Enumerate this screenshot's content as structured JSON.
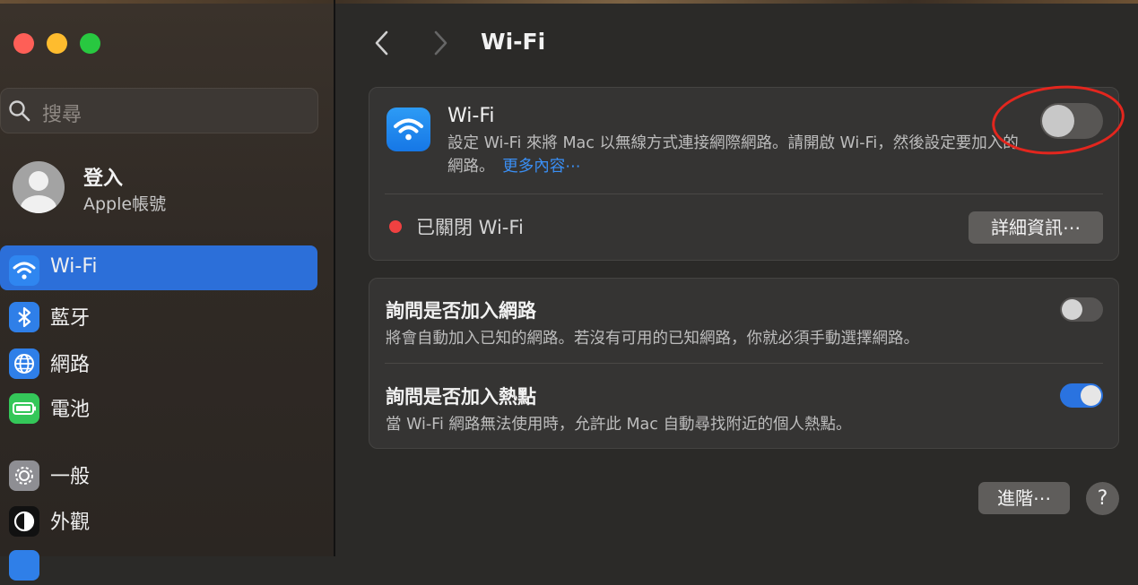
{
  "sidebar": {
    "search_placeholder": "搜尋",
    "account": {
      "title": "登入",
      "subtitle": "Apple帳號"
    },
    "items": [
      {
        "label": "Wi-Fi",
        "icon": "wifi-icon",
        "color": "#2c6fd9",
        "active": true
      },
      {
        "label": "藍牙",
        "icon": "bluetooth-icon",
        "color": "#2f7fe8"
      },
      {
        "label": "網路",
        "icon": "globe-icon",
        "color": "#2f7fe8"
      },
      {
        "label": "電池",
        "icon": "battery-icon",
        "color": "#34c759"
      },
      {
        "label": "一般",
        "icon": "gear-icon",
        "color": "#8e8e93"
      },
      {
        "label": "外觀",
        "icon": "appearance-icon",
        "color": "#1c1c1e"
      },
      {
        "label": "",
        "icon": "accessibility-icon",
        "color": "#2f7fe8"
      }
    ]
  },
  "header": {
    "title": "Wi-Fi"
  },
  "wifi_card": {
    "title": "Wi-Fi",
    "description": "設定 Wi-Fi 來將 Mac 以無線方式連接網際網路。請開啟 Wi-Fi，然後設定要加入的網路。",
    "more_link": "更多內容⋯",
    "toggle_on": false,
    "status": "已關閉 Wi-Fi",
    "details_button": "詳細資訊⋯"
  },
  "options_card": {
    "rows": [
      {
        "title": "詢問是否加入網路",
        "description": "將會自動加入已知的網路。若沒有可用的已知網路，你就必須手動選擇網路。",
        "toggle_on": false
      },
      {
        "title": "詢問是否加入熱點",
        "description": "當 Wi-Fi 網路無法使用時，允許此 Mac 自動尋找附近的個人熱點。",
        "toggle_on": true
      }
    ]
  },
  "footer": {
    "advanced_button": "進階⋯",
    "help_button": "?"
  },
  "colors": {
    "accent": "#2c6fd9",
    "annotation": "#e3261e",
    "status_off": "#f04141"
  }
}
